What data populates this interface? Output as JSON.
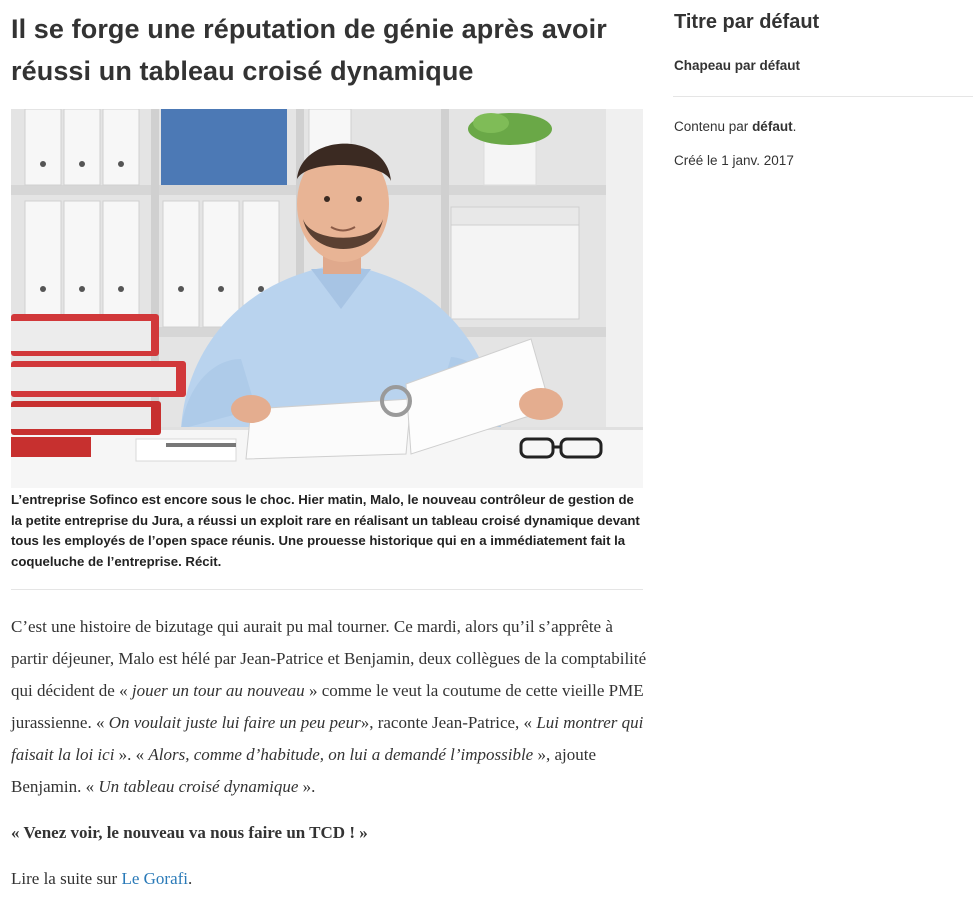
{
  "article": {
    "title": "Il se forge une réputation de génie après avoir réussi un tableau croisé dynamique",
    "caption": "L’entreprise Sofinco est encore sous le choc. Hier matin, Malo, le nouveau contrôleur de gestion de la petite entreprise du Jura, a réussi un exploit rare en réalisant un tableau croisé dynamique devant tous les employés de l’open space réunis. Une prouesse historique qui en a immédiatement fait la coqueluche de l’entreprise. Récit.",
    "p1": [
      "C’est une histoire de bizutage qui aurait pu mal tourner. Ce mardi, alors qu’il s’apprête à partir déjeuner, Malo est hélé par Jean-Patrice et Benjamin, deux collègues de la comptabilité qui décident de « ",
      "jouer un tour au nouveau",
      " » comme le veut la coutume de cette vieille PME jurassienne. « ",
      "On voulait juste lui faire un peu peur",
      "», raconte Jean-Patrice, « ",
      "Lui montrer qui faisait la loi ici",
      " ». « ",
      "Alors, comme d’habitude, on lui a demandé l’impossible",
      " », ajoute Benjamin. « ",
      "Un tableau croisé dynamique",
      " »."
    ],
    "quote": "« Venez voir, le nouveau va nous faire un TCD ! »",
    "more_prefix": "Lire la suite sur ",
    "more_link": "Le Gorafi",
    "more_suffix": "."
  },
  "sidebar": {
    "title": "Titre par défaut",
    "chapeau": "Chapeau par défaut",
    "content_prefix": "Contenu par ",
    "content_bold": "défaut",
    "content_suffix": ".",
    "date": "Créé le 1 janv. 2017"
  },
  "colors": {
    "link": "#2a7ab8",
    "binder_red": "#d1383a",
    "shirt": "#b9d3ee"
  }
}
